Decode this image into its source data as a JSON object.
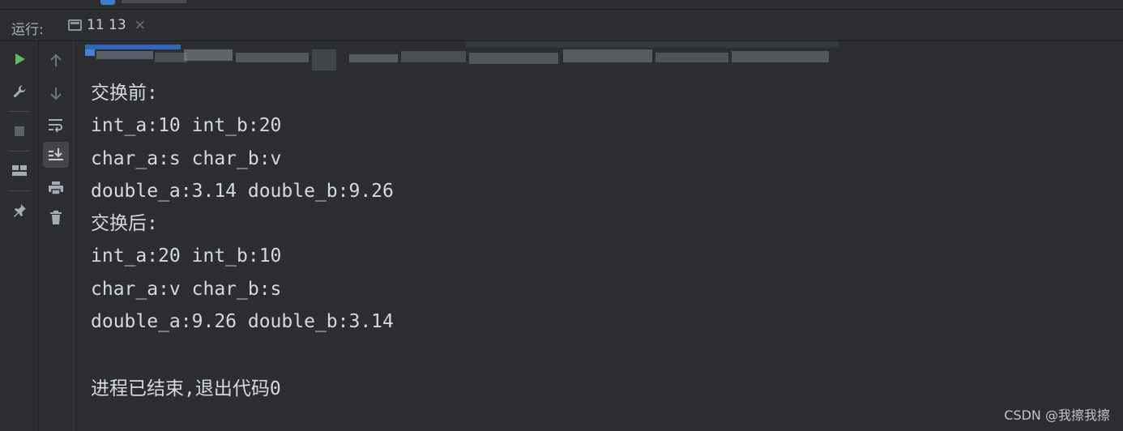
{
  "run_panel": {
    "label": "运行:",
    "tab_title": "11 13",
    "tab_close": "×"
  },
  "toolbar": {
    "left": [
      "run-icon",
      "wrench-icon",
      "stop-icon",
      "layout-icon",
      "pin-icon"
    ],
    "right": [
      "arrow-up-icon",
      "arrow-down-icon",
      "soft-wrap-icon",
      "scroll-to-end-icon",
      "print-icon",
      "trash-icon"
    ]
  },
  "console": {
    "lines": [
      "交换前:",
      "int_a:10 int_b:20",
      "char_a:s char_b:v",
      "double_a:3.14 double_b:9.26",
      "交换后:",
      "int_a:20 int_b:10",
      "char_a:v char_b:s",
      "double_a:9.26 double_b:3.14"
    ],
    "exit_message": "进程已结束,退出代码0"
  },
  "watermark": "CSDN @我擦我擦",
  "colors": {
    "background": "#2b2d30",
    "text": "#d5d8dd",
    "run_green": "#5fb865",
    "icon_gray": "#a6acb5"
  }
}
